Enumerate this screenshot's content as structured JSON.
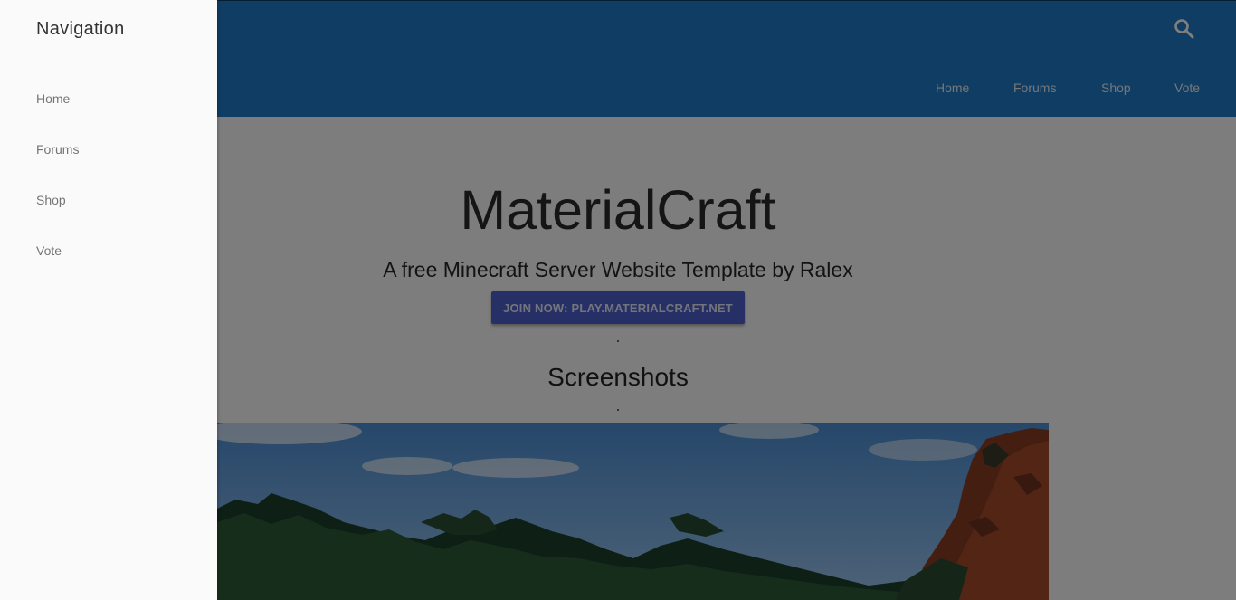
{
  "header": {
    "nav": [
      {
        "label": "Home"
      },
      {
        "label": "Forums"
      },
      {
        "label": "Shop"
      },
      {
        "label": "Vote"
      }
    ],
    "search_icon": "search-icon",
    "background_color": "#1f7bc8"
  },
  "hero": {
    "title": "MaterialCraft",
    "subtitle": "A free Minecraft Server Website Template by Ralex",
    "join_button_label": "JOIN NOW: PLAY.MATERIALCRAFT.NET",
    "button_color": "#4c60cc"
  },
  "screenshots": {
    "heading": "Screenshots"
  },
  "drawer": {
    "title": "Navigation",
    "items": [
      {
        "label": "Home"
      },
      {
        "label": "Forums"
      },
      {
        "label": "Shop"
      },
      {
        "label": "Vote"
      }
    ]
  }
}
